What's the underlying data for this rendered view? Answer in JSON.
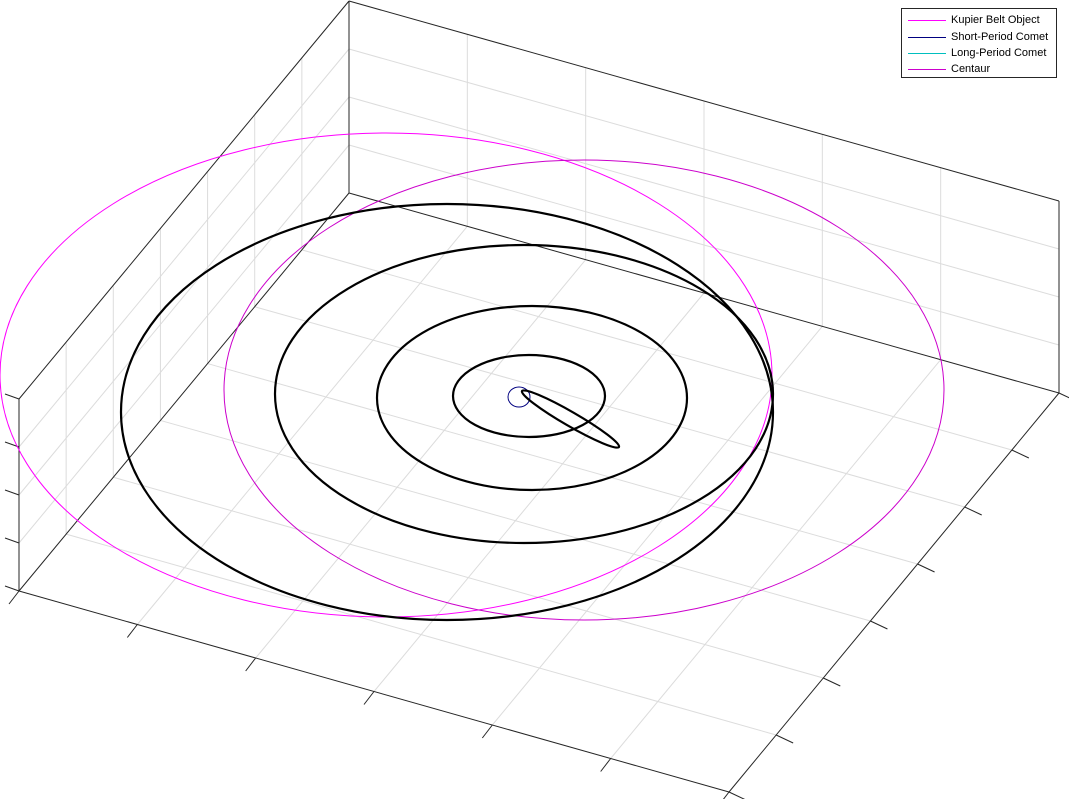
{
  "chart_data": {
    "type": "line",
    "title": "",
    "xlabel": "",
    "ylabel": "",
    "zlabel": "",
    "grid": true,
    "legend_position": "top-right",
    "legend": [
      {
        "name": "Kupier Belt Object",
        "color": "#ff00ff"
      },
      {
        "name": "Short-Period Comet",
        "color": "#000080"
      },
      {
        "name": "Long-Period Comet",
        "color": "#00bfbf"
      },
      {
        "name": "Centaur",
        "color": "#cc00cc"
      }
    ],
    "series": [
      {
        "name": "Kupier Belt Object",
        "color": "#ff00ff",
        "shape": "ellipse",
        "center": [
          386,
          375
        ],
        "semi_axes": [
          386,
          242
        ]
      },
      {
        "name": "Centaur",
        "color": "#cc00cc",
        "shape": "ellipse",
        "center": [
          584,
          390
        ],
        "semi_axes": [
          360,
          230
        ]
      },
      {
        "name": "Short-Period Comet",
        "color": "#000080",
        "shape": "ellipse",
        "center": [
          519,
          397
        ],
        "semi_axes": [
          11,
          10
        ]
      },
      {
        "name": "",
        "color": "#000000",
        "shape": "ellipse",
        "center": [
          529,
          396
        ],
        "semi_axes": [
          76,
          41
        ]
      },
      {
        "name": "",
        "color": "#000000",
        "shape": "ellipse",
        "center": [
          532,
          398
        ],
        "semi_axes": [
          155,
          92
        ]
      },
      {
        "name": "",
        "color": "#000000",
        "shape": "ellipse",
        "center": [
          524,
          394
        ],
        "semi_axes": [
          249,
          149
        ]
      },
      {
        "name": "",
        "color": "#000000",
        "shape": "ellipse",
        "center": [
          447,
          412
        ],
        "semi_axes": [
          326,
          208
        ]
      },
      {
        "name": "",
        "color": "#000000",
        "shape": "eccentric",
        "from": [
          522,
          391
        ],
        "to": [
          619,
          447
        ]
      }
    ]
  }
}
